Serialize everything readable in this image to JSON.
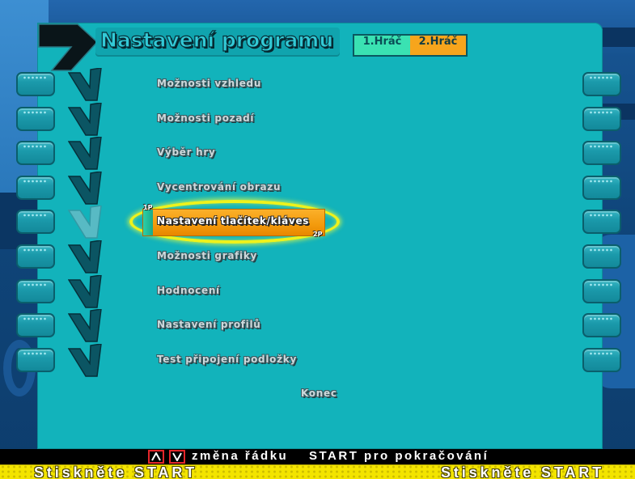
{
  "header": {
    "title": "Nastavení programu",
    "player_tabs": [
      {
        "label": "1.Hráč",
        "color": "#3ae2b2"
      },
      {
        "label": "2.Hráč",
        "color": "#f7a51c"
      }
    ]
  },
  "menu": {
    "selected_index": 4,
    "items": [
      {
        "label": "Možnosti vzhledu"
      },
      {
        "label": "Možnosti pozadí"
      },
      {
        "label": "Výběr hry"
      },
      {
        "label": "Vycentrování obrazu"
      },
      {
        "label": "Nastavení tlačítek/kláves"
      },
      {
        "label": "Možnosti grafiky"
      },
      {
        "label": "Hodnocení"
      },
      {
        "label": "Nastavení profilů"
      },
      {
        "label": "Test připojení podložky"
      }
    ],
    "exit_label": "Konec",
    "cursor_p1": "1P",
    "cursor_p2": "2P"
  },
  "footer": {
    "change_row_hint": "změna řádku",
    "continue_hint": "START pro pokračování",
    "press_start_left": "Stiskněte START",
    "press_start_right": "Stiskněte START"
  },
  "icons": {
    "header": "right-arrow-icon",
    "row_marker": "chevron-icon",
    "key_up": "up-arrow-key-icon",
    "key_down": "down-arrow-key-icon"
  },
  "colors": {
    "panel": "#12b3bb",
    "highlight_bar": "#f5a010",
    "highlight_ring": "#eef21c",
    "footer_band": "#f3e400",
    "key_border": "#e3262a"
  }
}
